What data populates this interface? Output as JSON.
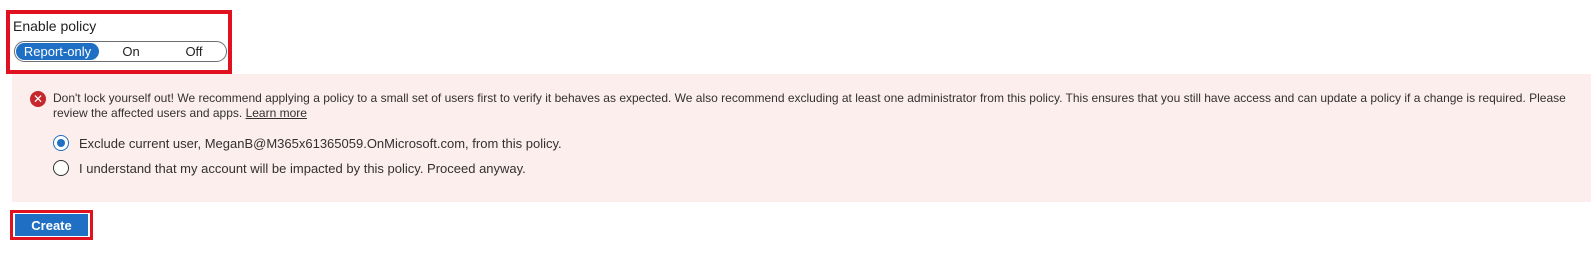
{
  "enable_policy": {
    "label": "Enable policy",
    "options": [
      "Report-only",
      "On",
      "Off"
    ],
    "selected": "Report-only"
  },
  "warning": {
    "message": "Don't lock yourself out! We recommend applying a policy to a small set of users first to verify it behaves as expected. We also recommend excluding at least one administrator from this policy. This ensures that you still have access and can update a policy if a change is required. Please review the affected users and apps.",
    "learn_more": "Learn more",
    "radio_options": [
      "Exclude current user, MeganB@M365x61365059.OnMicrosoft.com, from this policy.",
      "I understand that my account will be impacted by this policy. Proceed anyway."
    ],
    "selected_index": 0
  },
  "actions": {
    "create_label": "Create"
  },
  "colors": {
    "accent": "#1f6fc5",
    "error": "#c5272c",
    "banner_bg": "#fdeeee",
    "highlight": "#e0121f"
  },
  "icons": {
    "error": "error-x-icon"
  }
}
